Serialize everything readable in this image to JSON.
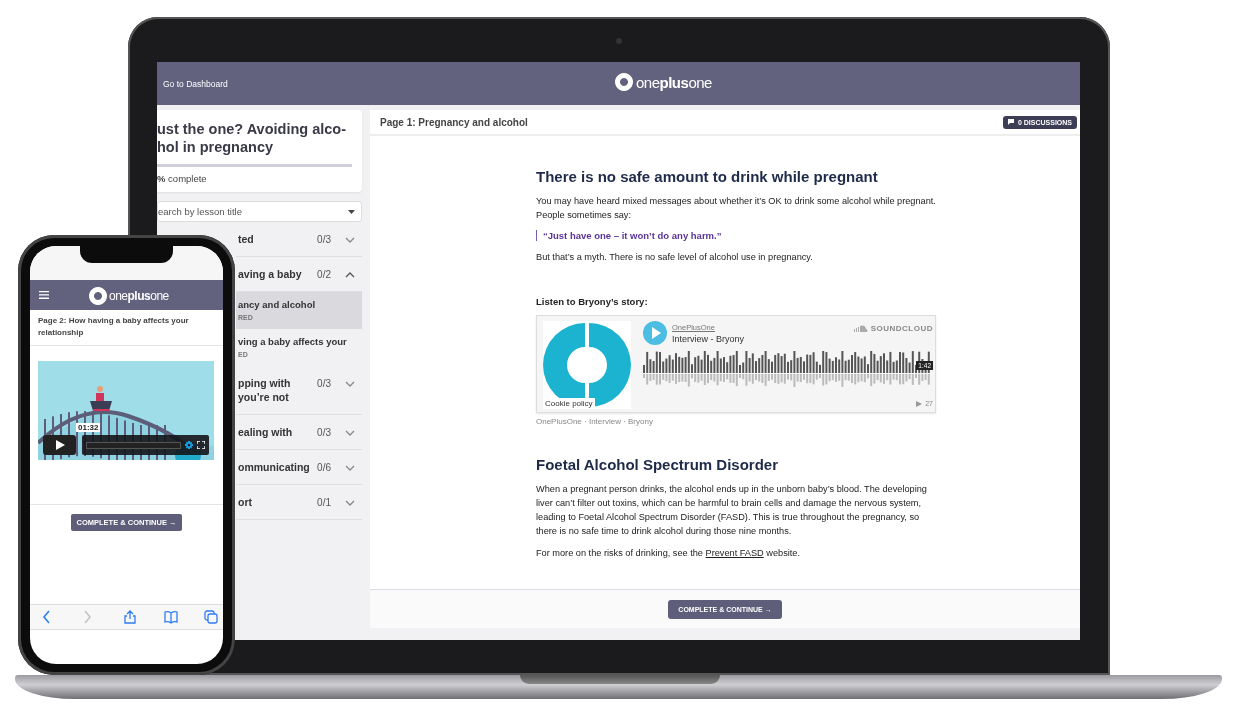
{
  "laptop": {
    "header": {
      "link": "Go to Dashboard",
      "logo": "one**plus**one"
    },
    "sidebar": {
      "course_title_lines": [
        "ust the one? Avoiding alco-",
        "hol in pregnancy"
      ],
      "progress": "**%** complete",
      "search": {
        "placeholder": "earch by lesson title"
      },
      "sections": [
        {
          "title_lines": [
            "ted"
          ],
          "count": "0/3",
          "expanded": false
        },
        {
          "title_lines": [
            "aving a baby"
          ],
          "count": "0/2",
          "expanded": true,
          "lessons": [
            {
              "title": "ancy and alcohol",
              "status": "RED",
              "selected": true
            },
            {
              "title": "ving a baby affects your",
              "status": "ED",
              "selected": false
            }
          ]
        },
        {
          "title_lines": [
            "pping with",
            "you’re not"
          ],
          "count": "0/3",
          "expanded": false
        },
        {
          "title_lines": [
            "ealing with"
          ],
          "count": "0/3",
          "expanded": false
        },
        {
          "title_lines": [
            "ommunicating"
          ],
          "count": "0/6",
          "expanded": false
        },
        {
          "title_lines": [
            "ort"
          ],
          "count": "0/1",
          "expanded": false
        }
      ]
    },
    "main": {
      "page_title": "Page 1: Pregnancy and alcohol",
      "discussions": "0 DISCUSSIONS",
      "article": [
        {
          "kind": "heading",
          "text": "There is no safe amount to drink while pregnant"
        },
        {
          "kind": "paragraph",
          "text": "You may have heard mixed messages about whether it’s OK to drink some alcohol while pregnant. People sometimes say:"
        },
        {
          "kind": "quote",
          "text": "“Just have one – it won’t do any harm.”"
        },
        {
          "kind": "paragraph",
          "text": "But that’s a myth. There is no safe level of alcohol use in pregnancy."
        },
        {
          "kind": "subheading",
          "text": "Listen to Bryony’s story:"
        },
        {
          "kind": "embed",
          "user": "OnePlusOne",
          "track": "Interview - Bryony",
          "brand": "SOUNDCLOUD",
          "duration": "1:42",
          "plays": "27",
          "cookie": "Cookie policy",
          "caption": "OnePlusOne · Interview · Bryony"
        },
        {
          "kind": "heading",
          "text": "Foetal Alcohol Spectrum Disorder"
        },
        {
          "kind": "paragraph",
          "text": "When a pregnant person drinks, the alcohol ends up in the unborn baby’s blood. The developing liver can’t filter out toxins, which can be harmful to brain cells and damage the nervous system, leading to Foetal Alcohol Spectrum Disorder (FASD). This is true throughout the pregnancy, so there is no safe time to drink alcohol during those nine months."
        },
        {
          "kind": "link_paragraph",
          "before": "For more on the risks of drinking, see the ",
          "link": "Prevent FASD",
          "after": " website."
        }
      ],
      "button": "COMPLETE & CONTINUE →"
    }
  },
  "phone": {
    "logo": "one**plus**one",
    "page_title": "Page 2: How having a baby affects your relationship",
    "video": {
      "time": "01:32"
    },
    "button": "COMPLETE & CONTINUE →",
    "toolbar": [
      {
        "kind": "back",
        "disabled": false
      },
      {
        "kind": "forward",
        "disabled": true
      },
      {
        "kind": "share",
        "disabled": false
      },
      {
        "kind": "bookmarks",
        "disabled": false
      },
      {
        "kind": "tabs",
        "disabled": false
      }
    ]
  }
}
